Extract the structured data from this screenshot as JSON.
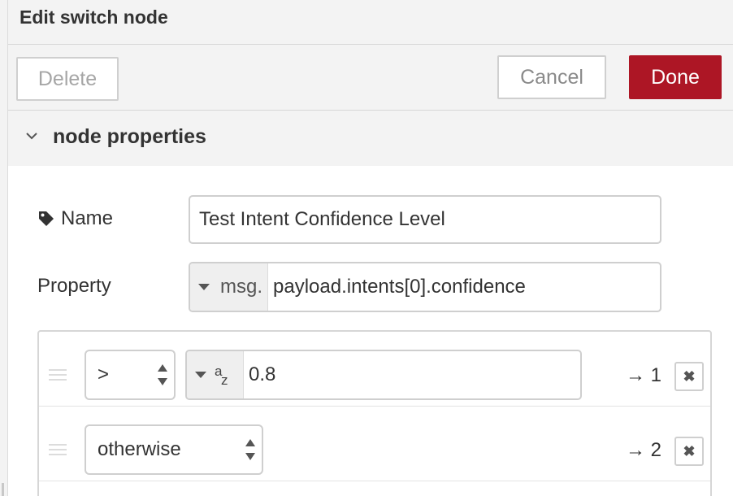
{
  "dialog": {
    "title": "Edit switch node"
  },
  "toolbar": {
    "delete_label": "Delete",
    "cancel_label": "Cancel",
    "done_label": "Done"
  },
  "section": {
    "label": "node properties",
    "icon": "chevron-down-icon"
  },
  "name_field": {
    "label": "Name",
    "icon": "tag-icon",
    "value": "Test Intent Confidence Level"
  },
  "property_field": {
    "label": "Property",
    "type_label": "msg.",
    "value": "payload.intents[0].confidence"
  },
  "rules": [
    {
      "operator": ">",
      "value_type_icon_a": "a",
      "value_type_icon_z": "z",
      "value": "0.8",
      "output": "→ 1",
      "remove_label": "✖"
    },
    {
      "operator": "otherwise",
      "output": "→ 2",
      "remove_label": "✖"
    }
  ],
  "colors": {
    "done_button": "#ad1625",
    "header_background": "#f3f3f3"
  }
}
